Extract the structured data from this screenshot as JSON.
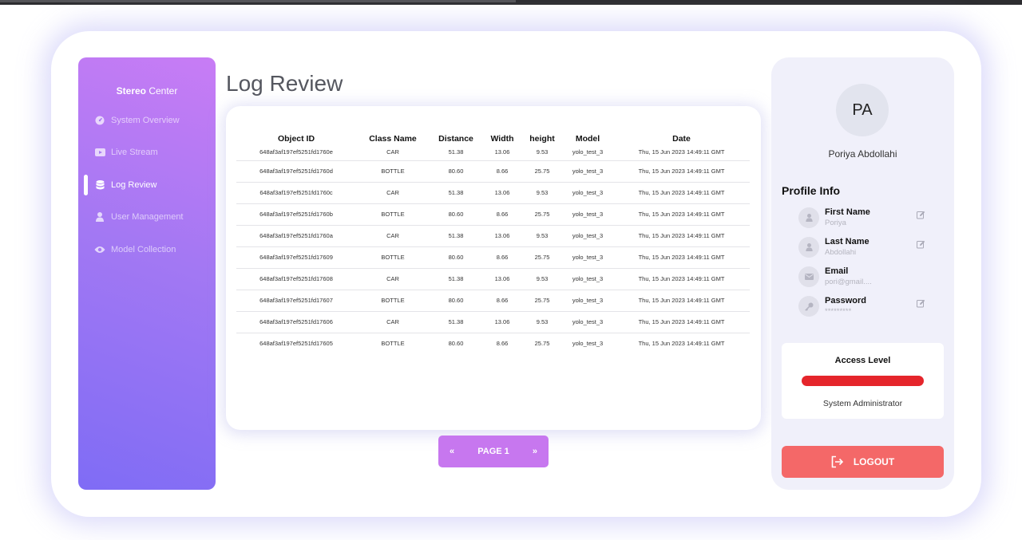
{
  "app": {
    "brand_bold": "Stereo",
    "brand_rest": " Center"
  },
  "sidebar": {
    "items": [
      {
        "label": "System Overview",
        "icon": "dashboard-icon",
        "active": false
      },
      {
        "label": "Live Stream",
        "icon": "video-icon",
        "active": false
      },
      {
        "label": "Log Review",
        "icon": "database-icon",
        "active": true
      },
      {
        "label": "User Management",
        "icon": "user-icon",
        "active": false
      },
      {
        "label": "Model Collection",
        "icon": "eye-icon",
        "active": false
      }
    ]
  },
  "page": {
    "title": "Log Review"
  },
  "table": {
    "columns": [
      "Object ID",
      "Class Name",
      "Distance",
      "Width",
      "height",
      "Model",
      "Date"
    ],
    "rows": [
      [
        "648af3af197ef5251fd1760e",
        "CAR",
        "51.38",
        "13.06",
        "9.53",
        "yolo_test_3",
        "Thu, 15 Jun 2023 14:49:11 GMT"
      ],
      [
        "648af3af197ef5251fd1760d",
        "BOTTLE",
        "80.60",
        "8.66",
        "25.75",
        "yolo_test_3",
        "Thu, 15 Jun 2023 14:49:11 GMT"
      ],
      [
        "648af3af197ef5251fd1760c",
        "CAR",
        "51.38",
        "13.06",
        "9.53",
        "yolo_test_3",
        "Thu, 15 Jun 2023 14:49:11 GMT"
      ],
      [
        "648af3af197ef5251fd1760b",
        "BOTTLE",
        "80.60",
        "8.66",
        "25.75",
        "yolo_test_3",
        "Thu, 15 Jun 2023 14:49:11 GMT"
      ],
      [
        "648af3af197ef5251fd1760a",
        "CAR",
        "51.38",
        "13.06",
        "9.53",
        "yolo_test_3",
        "Thu, 15 Jun 2023 14:49:11 GMT"
      ],
      [
        "648af3af197ef5251fd17609",
        "BOTTLE",
        "80.60",
        "8.66",
        "25.75",
        "yolo_test_3",
        "Thu, 15 Jun 2023 14:49:11 GMT"
      ],
      [
        "648af3af197ef5251fd17608",
        "CAR",
        "51.38",
        "13.06",
        "9.53",
        "yolo_test_3",
        "Thu, 15 Jun 2023 14:49:11 GMT"
      ],
      [
        "648af3af197ef5251fd17607",
        "BOTTLE",
        "80.60",
        "8.66",
        "25.75",
        "yolo_test_3",
        "Thu, 15 Jun 2023 14:49:11 GMT"
      ],
      [
        "648af3af197ef5251fd17606",
        "CAR",
        "51.38",
        "13.06",
        "9.53",
        "yolo_test_3",
        "Thu, 15 Jun 2023 14:49:11 GMT"
      ],
      [
        "648af3af197ef5251fd17605",
        "BOTTLE",
        "80.60",
        "8.66",
        "25.75",
        "yolo_test_3",
        "Thu, 15 Jun 2023 14:49:11 GMT"
      ]
    ]
  },
  "pager": {
    "prev": "«",
    "label": "PAGE 1",
    "next": "»"
  },
  "profile": {
    "initials": "PA",
    "name": "Poriya Abdollahi",
    "section_title": "Profile Info",
    "fields": [
      {
        "label": "First Name",
        "value": "Poriya",
        "icon": "user-icon",
        "editable": true
      },
      {
        "label": "Last Name",
        "value": "Abdollahi",
        "icon": "user-icon",
        "editable": true
      },
      {
        "label": "Email",
        "value": "pori@gmail....",
        "icon": "mail-icon",
        "editable": false
      },
      {
        "label": "Password",
        "value": "*********",
        "icon": "key-icon",
        "editable": true
      }
    ],
    "access": {
      "title": "Access Level",
      "role": "System Administrator",
      "bar_color": "#e5252b"
    },
    "logout_label": "LOGOUT"
  },
  "colors": {
    "sidebar_gradient_start": "#c87cf5",
    "sidebar_gradient_end": "#7f6cf5",
    "pager_bg": "#c777ef",
    "logout_bg": "#f46868"
  }
}
